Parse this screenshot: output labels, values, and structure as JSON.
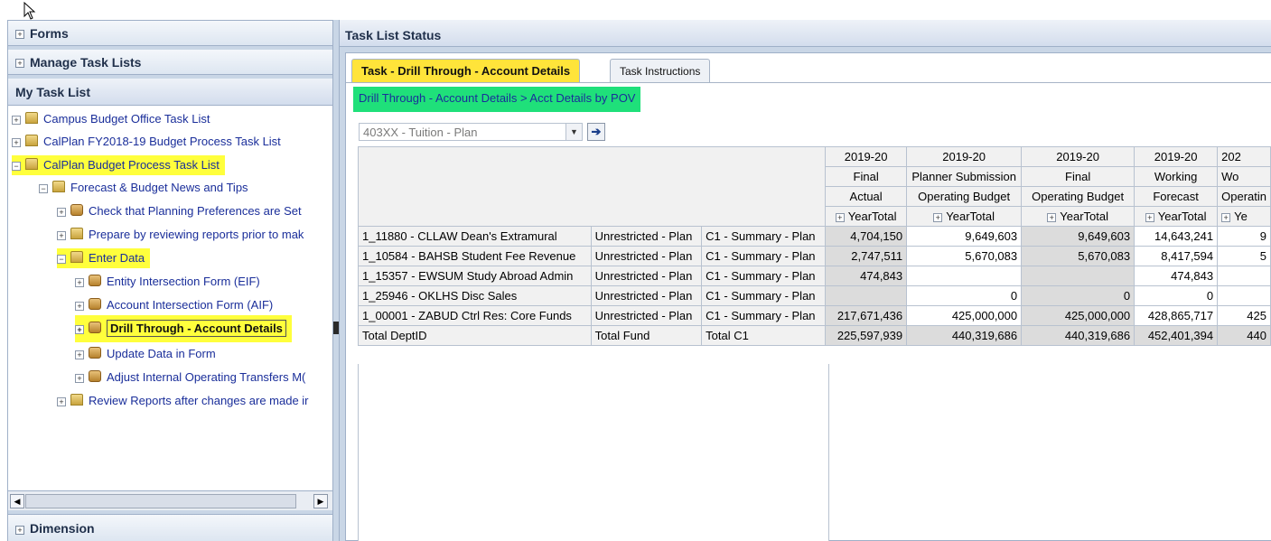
{
  "left_panel": {
    "forms_label": "Forms",
    "manage_label": "Manage Task Lists",
    "my_task_list_label": "My Task List",
    "dimension_label": "Dimension",
    "tree": [
      {
        "label": "Campus Budget Office Task List"
      },
      {
        "label": "CalPlan FY2018-19 Budget Process Task List"
      },
      {
        "label": "CalPlan Budget Process Task List"
      },
      {
        "label": "Forecast & Budget News and Tips"
      },
      {
        "label": "Check that Planning Preferences are Set"
      },
      {
        "label": "Prepare by reviewing reports prior to mak"
      },
      {
        "label": "Enter Data"
      },
      {
        "label": "Entity Intersection Form (EIF)"
      },
      {
        "label": "Account Intersection Form (AIF)"
      },
      {
        "label": "Drill Through - Account Details"
      },
      {
        "label": "Update Data in Form"
      },
      {
        "label": "Adjust Internal Operating Transfers M("
      },
      {
        "label": "Review Reports after changes are made ir"
      }
    ]
  },
  "right_panel": {
    "title": "Task List Status",
    "tabs": [
      {
        "label": "Task - Drill Through - Account Details"
      },
      {
        "label": "Task Instructions"
      }
    ],
    "breadcrumb": "Drill Through - Account Details > Acct Details by POV",
    "pov_value": "403XX - Tuition - Plan",
    "go_symbol": "➔"
  },
  "grid": {
    "col_headers": [
      [
        "2019-20",
        "2019-20",
        "2019-20",
        "2019-20",
        "202"
      ],
      [
        "Final",
        "Planner Submission",
        "Final",
        "Working",
        "Wo"
      ],
      [
        "Actual",
        "Operating Budget",
        "Operating Budget",
        "Forecast",
        "Operatin"
      ],
      [
        "YearTotal",
        "YearTotal",
        "YearTotal",
        "YearTotal",
        "Ye"
      ]
    ],
    "rows": [
      {
        "dept": "1_11880 - CLLAW Dean's Extramural",
        "fund": "Unrestricted - Plan",
        "c1": "C1 - Summary - Plan",
        "vals": [
          "4,704,150",
          "9,649,603",
          "9,649,603",
          "14,643,241",
          "9"
        ]
      },
      {
        "dept": "1_10584 - BAHSB Student Fee Revenue",
        "fund": "Unrestricted - Plan",
        "c1": "C1 - Summary - Plan",
        "vals": [
          "2,747,511",
          "5,670,083",
          "5,670,083",
          "8,417,594",
          "5"
        ]
      },
      {
        "dept": "1_15357 - EWSUM Study Abroad Admin",
        "fund": "Unrestricted - Plan",
        "c1": "C1 - Summary - Plan",
        "vals": [
          "474,843",
          "",
          "",
          "474,843",
          ""
        ]
      },
      {
        "dept": "1_25946 - OKLHS Disc Sales",
        "fund": "Unrestricted - Plan",
        "c1": "C1 - Summary - Plan",
        "vals": [
          "",
          "0",
          "0",
          "0",
          ""
        ]
      },
      {
        "dept": "1_00001 - ZABUD Ctrl Res: Core Funds",
        "fund": "Unrestricted - Plan",
        "c1": "C1 - Summary - Plan",
        "vals": [
          "217,671,436",
          "425,000,000",
          "425,000,000",
          "428,865,717",
          "425"
        ]
      },
      {
        "dept": "Total DeptID",
        "fund": "Total Fund",
        "c1": "Total C1",
        "vals": [
          "225,597,939",
          "440,319,686",
          "440,319,686",
          "452,401,394",
          "440"
        ]
      }
    ]
  }
}
